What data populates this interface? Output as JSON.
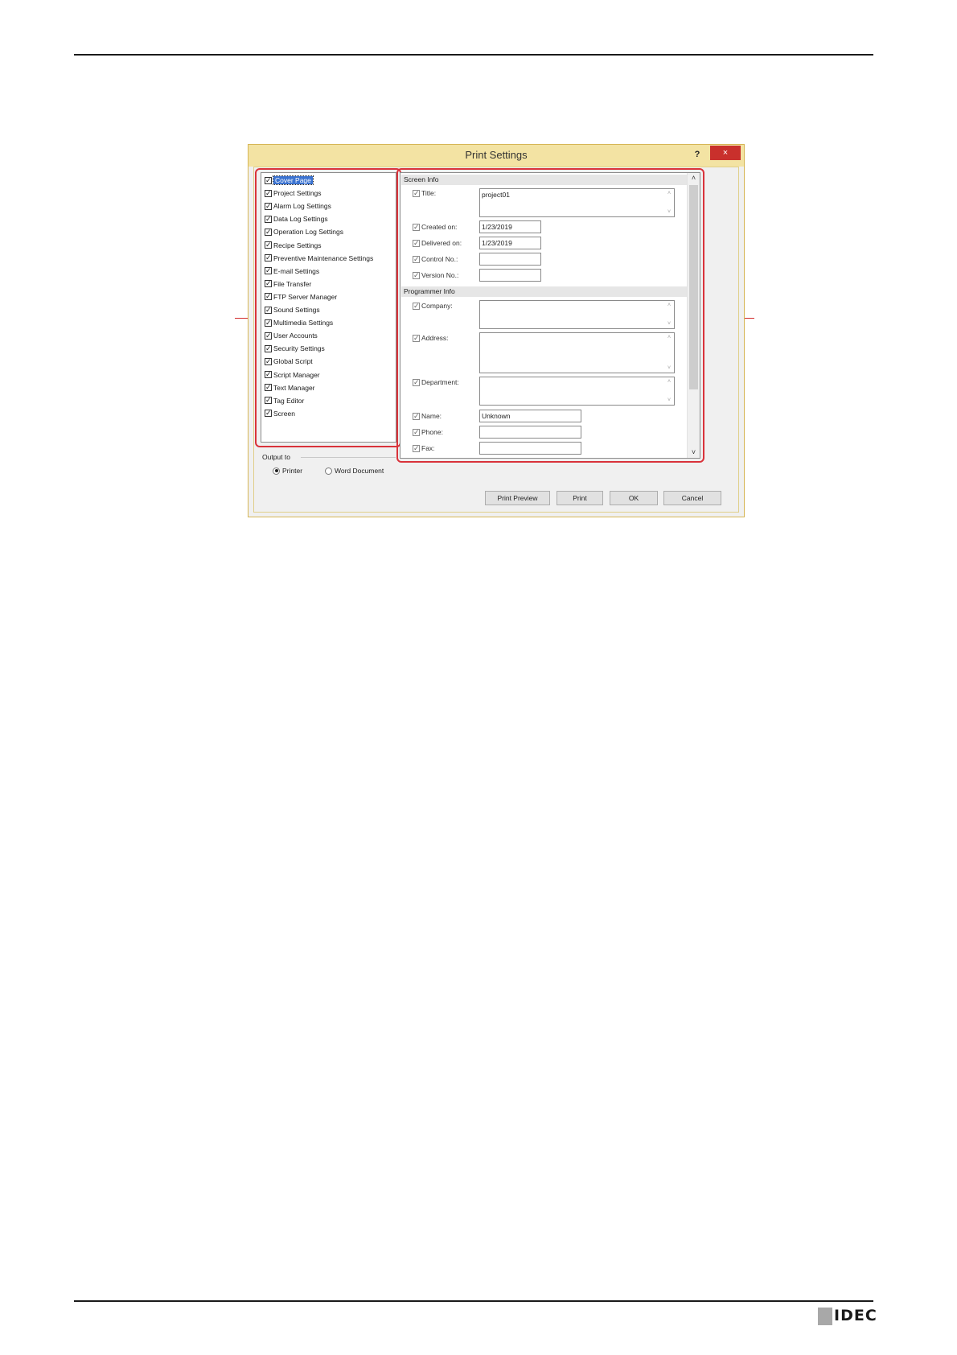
{
  "dialog": {
    "title": "Print Settings",
    "help_label": "?",
    "close_label": "×"
  },
  "left_list": {
    "items": [
      {
        "label": "Cover Page",
        "checked": true,
        "selected": true
      },
      {
        "label": "Project Settings",
        "checked": true
      },
      {
        "label": "Alarm Log Settings",
        "checked": true
      },
      {
        "label": "Data Log Settings",
        "checked": true
      },
      {
        "label": "Operation Log Settings",
        "checked": true
      },
      {
        "label": "Recipe Settings",
        "checked": true
      },
      {
        "label": "Preventive Maintenance Settings",
        "checked": true
      },
      {
        "label": "E-mail Settings",
        "checked": true
      },
      {
        "label": "File Transfer",
        "checked": true
      },
      {
        "label": "FTP Server Manager",
        "checked": true
      },
      {
        "label": "Sound Settings",
        "checked": true
      },
      {
        "label": "Multimedia Settings",
        "checked": true
      },
      {
        "label": "User Accounts",
        "checked": true
      },
      {
        "label": "Security Settings",
        "checked": true
      },
      {
        "label": "Global Script",
        "checked": true
      },
      {
        "label": "Script Manager",
        "checked": true
      },
      {
        "label": "Text Manager",
        "checked": true
      },
      {
        "label": "Tag Editor",
        "checked": true
      },
      {
        "label": "Screen",
        "checked": true
      }
    ]
  },
  "output": {
    "group_label": "Output to",
    "printer_label": "Printer",
    "word_label": "Word Document",
    "selected": "Printer"
  },
  "screen_info": {
    "section_label": "Screen Info",
    "title_label": "Title:",
    "title_value": "project01",
    "created_label": "Created on:",
    "created_value": "1/23/2019",
    "delivered_label": "Delivered on:",
    "delivered_value": "1/23/2019",
    "control_label": "Control No.:",
    "control_value": "",
    "version_label": "Version No.:",
    "version_value": ""
  },
  "programmer_info": {
    "section_label": "Programmer Info",
    "company_label": "Company:",
    "company_value": "",
    "address_label": "Address:",
    "address_value": "",
    "department_label": "Department:",
    "department_value": "",
    "name_label": "Name:",
    "name_value": "Unknown",
    "phone_label": "Phone:",
    "phone_value": "",
    "fax_label": "Fax:",
    "fax_value": ""
  },
  "buttons": {
    "print_preview": "Print Preview",
    "print": "Print",
    "ok": "OK",
    "cancel": "Cancel"
  },
  "footer": {
    "logo_text": "IDEC"
  },
  "colors": {
    "highlight": "#d9333b",
    "titlebar": "#f3e3a3",
    "selection": "#3b73d1"
  }
}
